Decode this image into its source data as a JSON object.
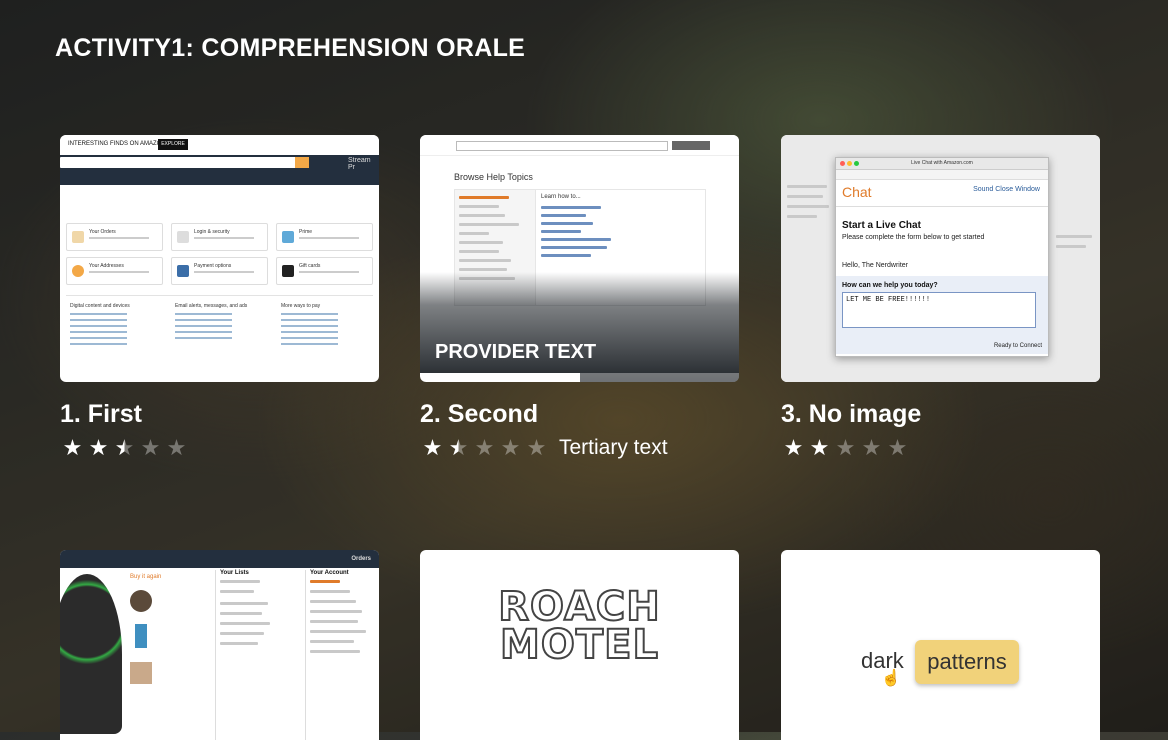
{
  "page": {
    "title": "ACTIVITY1: COMPREHENSION ORALE"
  },
  "cards": [
    {
      "title": "1. First",
      "rating": 2.5,
      "max": 5,
      "tertiary": ""
    },
    {
      "title": "2. Second",
      "rating": 1.5,
      "max": 5,
      "tertiary": "Tertiary text",
      "provider": "PROVIDER TEXT",
      "progress": 0.5
    },
    {
      "title": "3. No image",
      "rating": 2,
      "max": 5,
      "tertiary": ""
    },
    {
      "title": "",
      "rating": null,
      "tertiary": ""
    },
    {
      "title": "",
      "rating": null,
      "tertiary": ""
    },
    {
      "title": "",
      "rating": null,
      "tertiary": ""
    }
  ],
  "thumbs": {
    "amazon": {
      "topbar_text": "INTERESTING FINDS ON AMAZON",
      "explore": "EXPLORE",
      "prime_label": "Stream Pr",
      "tiles": [
        [
          "Your Orders",
          "Login & security",
          "Prime"
        ],
        [
          "Your Addresses",
          "Payment options",
          "Gift cards"
        ]
      ],
      "sections": [
        "Digital content and devices",
        "Email alerts, messages, and ads",
        "More ways to pay"
      ]
    },
    "help": {
      "heading": "Browse Help Topics",
      "learn": "Learn how to..."
    },
    "chat": {
      "window_title": "Live Chat with Amazon.com",
      "brand": "Chat",
      "links": "Sound  Close Window",
      "heading": "Start a Live Chat",
      "subheading": "Please complete the form below to get started",
      "hello": "Hello, The Nerdwriter",
      "question": "How can we help you today?",
      "message": "LET ME BE FREE!!!!!!",
      "status": "Ready to Connect"
    },
    "amazon2": {
      "nav_right": "Orders",
      "buy_again": "Buy it again",
      "lists": "Your Lists",
      "account": "Your Account"
    },
    "roach": {
      "line1": "ROACH",
      "line2": "MOTEL"
    },
    "dark_patterns": {
      "word1": "dark",
      "word2": "patterns"
    }
  },
  "colors": {
    "accent_orange": "#f3a847",
    "amazon_navy": "#232f3e",
    "chip_yellow": "#f1d27a"
  }
}
